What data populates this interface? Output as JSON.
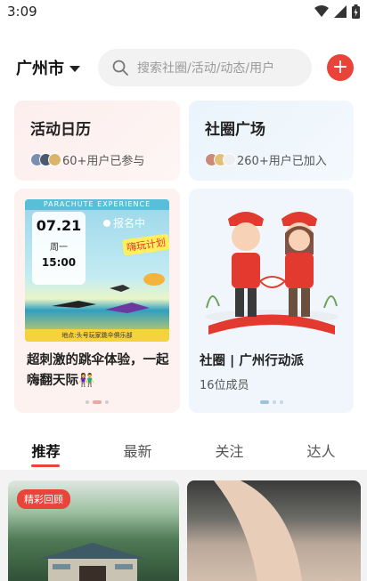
{
  "status_bar": {
    "time": "3:09"
  },
  "header": {
    "city": "广州市",
    "search_placeholder": "搜索社圈/活动/动态/用户",
    "add_label": "+"
  },
  "shortcuts": [
    {
      "title": "活动日历",
      "subtitle": "60+用户已参与"
    },
    {
      "title": "社圈广场",
      "subtitle": "260+用户已加入"
    }
  ],
  "activity": {
    "poster_banner": "PARACHUTE EXPERIENCE",
    "date": "07.21",
    "weekday": "周一",
    "time": "15:00",
    "status": "报名中",
    "slogan": "嗨玩计划",
    "poster_footer": "地点:头号玩家跳伞俱乐部",
    "caption": "超刺激的跳伞体验，一起嗨翻天际👫"
  },
  "community": {
    "name": "社圈 | 广州行动派",
    "members": "16位成员"
  },
  "tabs": [
    "推荐",
    "最新",
    "关注",
    "达人"
  ],
  "feed": {
    "left_tag": "精彩回顾"
  },
  "colors": {
    "accent": "#e9433a",
    "search_bg": "#f2f2f2"
  }
}
